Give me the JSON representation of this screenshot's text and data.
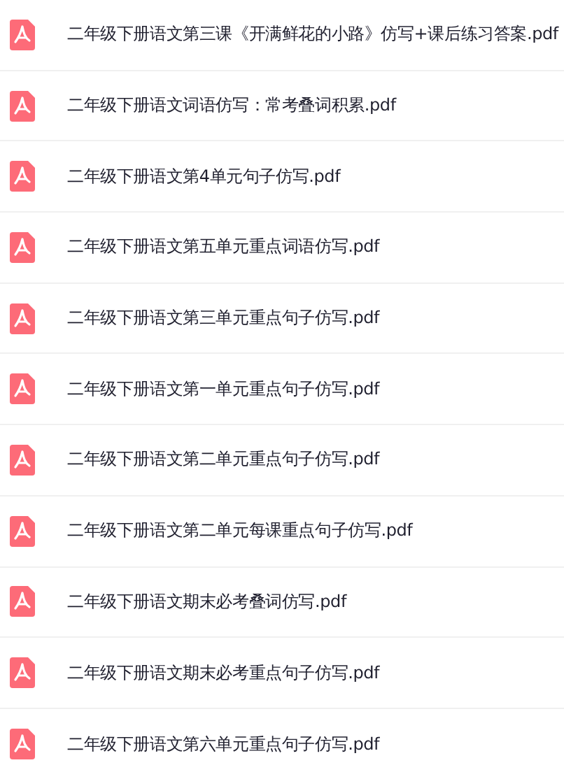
{
  "files": [
    {
      "name": "二年级下册语文第三课《开满鲜花的小路》仿写+课后练习答案.pdf"
    },
    {
      "name": "二年级下册语文词语仿写：常考叠词积累.pdf"
    },
    {
      "name": "二年级下册语文第4单元句子仿写.pdf"
    },
    {
      "name": "二年级下册语文第五单元重点词语仿写.pdf"
    },
    {
      "name": "二年级下册语文第三单元重点句子仿写.pdf"
    },
    {
      "name": "二年级下册语文第一单元重点句子仿写.pdf"
    },
    {
      "name": "二年级下册语文第二单元重点句子仿写.pdf"
    },
    {
      "name": "二年级下册语文第二单元每课重点句子仿写.pdf"
    },
    {
      "name": "二年级下册语文期末必考叠词仿写.pdf"
    },
    {
      "name": "二年级下册语文期末必考重点句子仿写.pdf"
    },
    {
      "name": "二年级下册语文第六单元重点句子仿写.pdf"
    }
  ]
}
